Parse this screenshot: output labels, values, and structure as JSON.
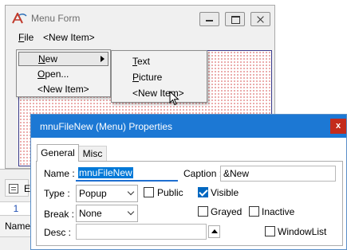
{
  "form_window": {
    "title": "Menu Form",
    "menubar": [
      "File",
      "<New Item>"
    ]
  },
  "file_menu": {
    "items": [
      "New",
      "Open...",
      "<New Item>"
    ]
  },
  "new_submenu": {
    "items": [
      "Text",
      "Picture",
      "<New Item>"
    ]
  },
  "left_panel": {
    "toolbar_label": "E",
    "row_number": "1",
    "column_header": "Name"
  },
  "dialog": {
    "title": "mnuFileNew (Menu) Properties",
    "close_label": "x",
    "tabs": [
      "General",
      "Misc"
    ],
    "name_label": "Name :",
    "name_value": "mnuFileNew",
    "caption_label": "Caption :",
    "caption_value": "&New",
    "type_label": "Type :",
    "type_value": "Popup",
    "break_label": "Break :",
    "break_value": "None",
    "desc_label": "Desc :",
    "desc_value": "",
    "checkboxes": {
      "public": {
        "label": "Public",
        "checked": false
      },
      "visible": {
        "label": "Visible",
        "checked": true
      },
      "grayed": {
        "label": "Grayed",
        "checked": false
      },
      "inactive": {
        "label": "Inactive",
        "checked": false
      },
      "windowlist": {
        "label": "WindowList",
        "checked": false
      }
    }
  },
  "colors": {
    "dialog_titlebar": "#1c78d4",
    "close_button": "#c42b1c",
    "selection": "#0078d7",
    "grid_dots": "#d04040"
  }
}
